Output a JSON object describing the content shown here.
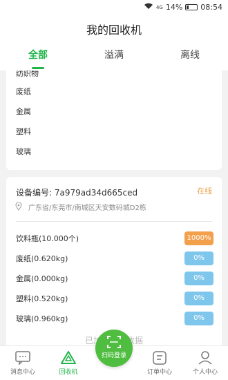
{
  "status_bar": {
    "battery": "14%",
    "time": "08:54",
    "network": "4G"
  },
  "header": {
    "title": "我的回收机"
  },
  "tabs": [
    {
      "label": "全部",
      "active": true
    },
    {
      "label": "溢满",
      "active": false
    },
    {
      "label": "离线",
      "active": false
    }
  ],
  "top_card": {
    "rows": [
      "纺织物",
      "废纸",
      "金属",
      "塑料",
      "玻璃"
    ]
  },
  "device": {
    "id_label": "设备编号: 7a979ad34d665ced",
    "status": "在线",
    "address": "广东省/东莞市/南城区天安数码城D2栋",
    "items": [
      {
        "name": "饮料瓶(10.000个)",
        "pct": "1000%",
        "level": 10.0
      },
      {
        "name": "废纸(0.620kg)",
        "pct": "0%",
        "level": 0
      },
      {
        "name": "金属(0.000kg)",
        "pct": "0%",
        "level": 0
      },
      {
        "name": "塑料(0.520kg)",
        "pct": "0%",
        "level": 0
      },
      {
        "name": "玻璃(0.960kg)",
        "pct": "0%",
        "level": 0
      }
    ]
  },
  "bottom_tip": "已加载全部数据",
  "bottom_nav": [
    {
      "label": "消息中心",
      "icon": "message-icon",
      "active": false
    },
    {
      "label": "回收机",
      "icon": "recycle-icon",
      "active": true
    },
    {
      "label": "扫码登录",
      "icon": "scan-icon",
      "active": false
    },
    {
      "label": "订单中心",
      "icon": "order-icon",
      "active": false
    },
    {
      "label": "个人中心",
      "icon": "person-icon",
      "active": false
    }
  ],
  "colors": {
    "accent": "#21b44b",
    "online": "#e8a14a",
    "full_badge": "#f3a04c",
    "normal_badge": "#7fc6ec",
    "scan_button": "#4fbd3f"
  }
}
